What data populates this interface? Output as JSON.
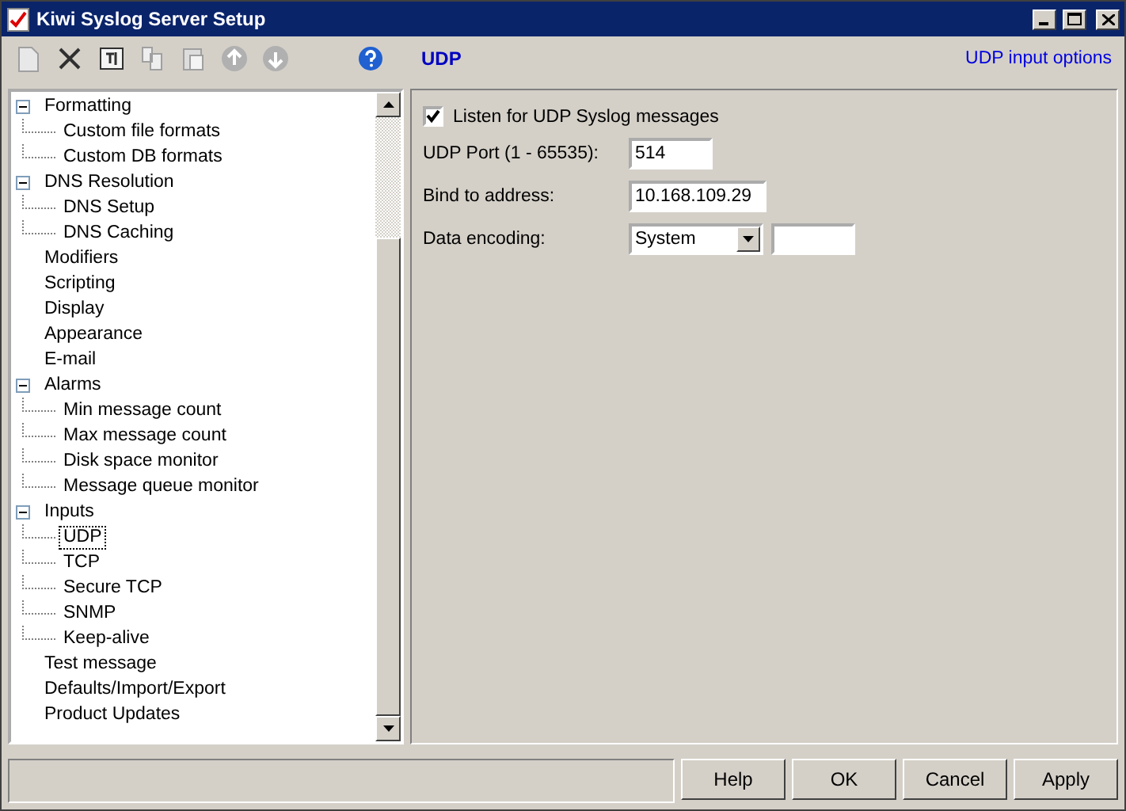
{
  "window": {
    "title": "Kiwi Syslog Server Setup"
  },
  "toolbar": [
    {
      "kind": "new",
      "disabled": true
    },
    {
      "kind": "delete",
      "disabled": false
    },
    {
      "kind": "rename",
      "disabled": false
    },
    {
      "kind": "copy",
      "disabled": true
    },
    {
      "kind": "paste",
      "disabled": true
    },
    {
      "kind": "up",
      "disabled": true
    },
    {
      "kind": "down",
      "disabled": true
    },
    {
      "kind": "help",
      "disabled": false
    }
  ],
  "tree": [
    {
      "label": "Formatting",
      "expanded": true,
      "selected": false,
      "children": [
        {
          "label": "Custom file formats",
          "selected": false
        },
        {
          "label": "Custom DB formats",
          "selected": false
        }
      ]
    },
    {
      "label": "DNS Resolution",
      "expanded": true,
      "selected": false,
      "children": [
        {
          "label": "DNS Setup",
          "selected": false
        },
        {
          "label": "DNS Caching",
          "selected": false
        }
      ]
    },
    {
      "label": "Modifiers",
      "selected": false
    },
    {
      "label": "Scripting",
      "selected": false
    },
    {
      "label": "Display",
      "selected": false
    },
    {
      "label": "Appearance",
      "selected": false
    },
    {
      "label": "E-mail",
      "selected": false
    },
    {
      "label": "Alarms",
      "expanded": true,
      "selected": false,
      "children": [
        {
          "label": "Min message count",
          "selected": false
        },
        {
          "label": "Max message count",
          "selected": false
        },
        {
          "label": "Disk space monitor",
          "selected": false
        },
        {
          "label": "Message queue monitor",
          "selected": false
        }
      ]
    },
    {
      "label": "Inputs",
      "expanded": true,
      "selected": false,
      "children": [
        {
          "label": "UDP",
          "selected": true
        },
        {
          "label": "TCP",
          "selected": false
        },
        {
          "label": "Secure TCP",
          "selected": false
        },
        {
          "label": "SNMP",
          "selected": false
        },
        {
          "label": "Keep-alive",
          "selected": false
        }
      ]
    },
    {
      "label": "Test message",
      "selected": false
    },
    {
      "label": "Defaults/Import/Export",
      "selected": false
    },
    {
      "label": "Product Updates",
      "selected": false
    }
  ],
  "panel": {
    "title": "UDP",
    "link": "UDP input options",
    "checkbox": {
      "label": "Listen for UDP Syslog messages",
      "checked": true
    },
    "fields": [
      {
        "kind": "text",
        "label": "UDP Port (1 - 65535):",
        "value": "514"
      },
      {
        "kind": "text",
        "label": "Bind to address:",
        "value": "10.168.109.29"
      },
      {
        "kind": "dropdown",
        "label": "Data encoding:",
        "value": "System"
      }
    ]
  },
  "buttons": [
    "Help",
    "OK",
    "Cancel",
    "Apply"
  ]
}
